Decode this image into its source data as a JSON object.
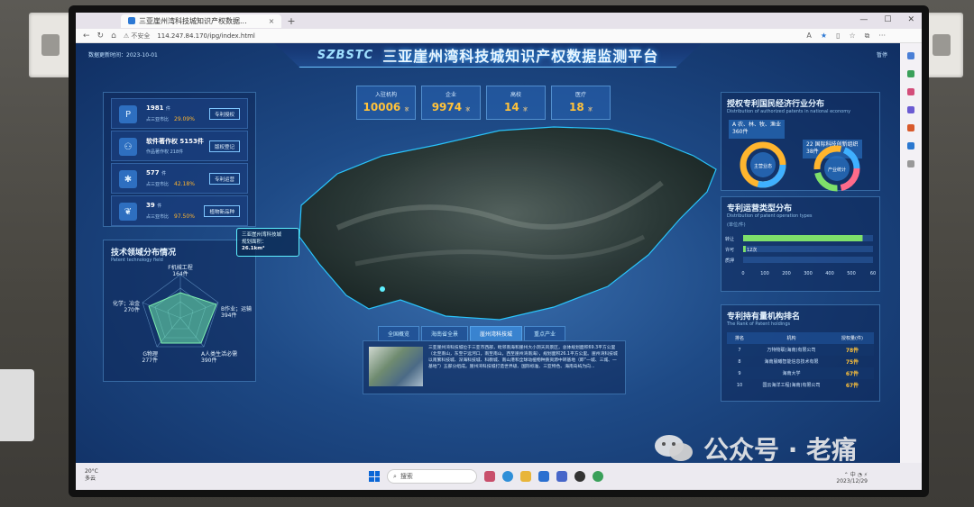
{
  "browser": {
    "tab_title": "三亚崖州湾科技城知识产权数据...",
    "tab_close": "×",
    "new_tab": "+",
    "security": "不安全",
    "url": "114.247.84.170/ipg/index.html"
  },
  "dashboard": {
    "header_date": "数据更新时间：2023-10-01",
    "user": "暂停",
    "logo_text": "SZBSTC",
    "title": "三亚崖州湾科技城知识产权数据监测平台"
  },
  "stats": [
    {
      "icon": "P",
      "value": "1981",
      "unit": "件",
      "label": "占三亚市比",
      "pct": "29.09%",
      "button": "专利授权"
    },
    {
      "icon": "⚇",
      "value": "软件著作权 5153件",
      "unit": "",
      "label": "作品著作权 218件",
      "pct": "",
      "button": "版权登记"
    },
    {
      "icon": "✱",
      "value": "577",
      "unit": "件",
      "label": "占三亚市比",
      "pct": "42.18%",
      "button": "专利运营"
    },
    {
      "icon": "❦",
      "value": "39",
      "unit": "件",
      "label": "占三亚市比",
      "pct": "97.50%",
      "button": "植物新品种"
    }
  ],
  "kpis": [
    {
      "label": "入驻机构",
      "value": "10006",
      "unit": "家"
    },
    {
      "label": "企业",
      "value": "9974",
      "unit": "家"
    },
    {
      "label": "高校",
      "value": "14",
      "unit": "家"
    },
    {
      "label": "医疗",
      "value": "18",
      "unit": "家"
    }
  ],
  "map": {
    "label_line1": "三亚崖州湾科技城",
    "label_line2": "规划面积：",
    "label_line3": "26.1km²",
    "tabs": [
      "全国概览",
      "海南省全景",
      "崖州湾科技城",
      "重点产业"
    ],
    "active_tab": 2,
    "intro": "三亚崖州湾科技城位于三亚市西部，毗邻南海和崖州大小洞天风景区，总体规划面积69.3平方公里（北至南山，东至宁远河口，南至南山，西至崖州湾南海），规划面积26.1平方公里。崖州湾科技城以南繁科技城、深海科技城、科教城、南山港和全球动植物种质资源中转基地（即“一城、三城、一基地”）五部分组成。崖州湾科技城打造世界级、国际标准、三亚特色、海南岛屿为向..."
  },
  "radar": {
    "title": "技术领域分布情况",
    "subtitle": "Patent technology field",
    "axes": [
      {
        "name": "F机械工程",
        "count": "164件"
      },
      {
        "name": "B作业；运输",
        "count": "394件"
      },
      {
        "name": "A人类生活必需",
        "count": "390件"
      },
      {
        "name": "G物理",
        "count": "277件"
      },
      {
        "name": "化学；冶金",
        "count": "270件"
      }
    ]
  },
  "pies": {
    "title": "授权专利国民经济行业分布",
    "subtitle": "Distribution of authorized patents in national economy",
    "left_label": "A 农、林、牧、渔业",
    "left_value": "360件",
    "left_center": "主营业态",
    "right_label": "22 国际科技创新组织",
    "right_value": "38件",
    "right_center": "产业统计"
  },
  "ops": {
    "title": "专利运营类型分布",
    "subtitle": "Distribution of patent operation types",
    "unit": "(单位/件)",
    "rows": [
      {
        "name": "转让",
        "value": 552,
        "label": ""
      },
      {
        "name": "许可",
        "value": 12,
        "label": "12次"
      },
      {
        "name": "质押",
        "value": 0,
        "label": ""
      }
    ],
    "ticks": [
      "0",
      "100",
      "200",
      "300",
      "400",
      "500",
      "60"
    ]
  },
  "rank": {
    "title": "专利持有量机构排名",
    "subtitle": "The Rank of Patent holdings",
    "headers": [
      "排名",
      "机构",
      "授权量(件)"
    ],
    "rows": [
      {
        "rank": "7",
        "name": "万特物联(海南)有限公司",
        "count": "78件"
      },
      {
        "rank": "8",
        "name": "海南晨曦智能信息技术有限",
        "count": "75件"
      },
      {
        "rank": "9",
        "name": "海南大学",
        "count": "67件"
      },
      {
        "rank": "10",
        "name": "国云海洋工程(海南)有限公司",
        "count": "67件"
      }
    ]
  },
  "taskbar": {
    "temp": "20°C",
    "weather": "多云",
    "search": "搜索",
    "date": "2023/12/29"
  },
  "watermark": "公众号 · 老痛",
  "colors": {
    "accent": "#ffc23a",
    "panel_border": "#6ebeff",
    "bar_green": "#7ee06a"
  }
}
